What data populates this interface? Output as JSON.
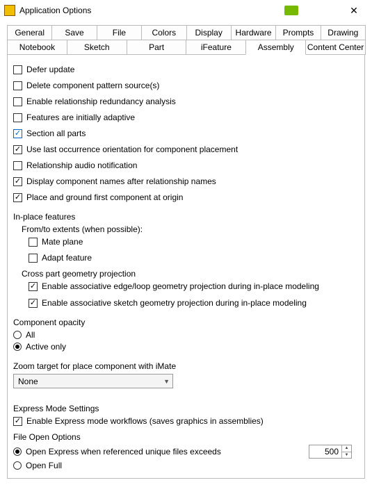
{
  "window": {
    "title": "Application Options",
    "close_symbol": "✕"
  },
  "tabs_row1": {
    "general": "General",
    "save": "Save",
    "file": "File",
    "colors": "Colors",
    "display": "Display",
    "hardware": "Hardware",
    "prompts": "Prompts",
    "drawing": "Drawing"
  },
  "tabs_row2": {
    "notebook": "Notebook",
    "sketch": "Sketch",
    "part": "Part",
    "ifeature": "iFeature",
    "assembly": "Assembly",
    "content_center": "Content Center"
  },
  "options": {
    "defer_update": "Defer update",
    "delete_pattern": "Delete component pattern source(s)",
    "enable_redundancy": "Enable relationship redundancy analysis",
    "features_adaptive": "Features are initially adaptive",
    "section_all": "Section all parts",
    "use_last_occ": "Use last occurrence orientation for component placement",
    "audio_notif": "Relationship audio notification",
    "display_names": "Display component names after relationship names",
    "place_ground": "Place and ground first component at origin"
  },
  "inplace": {
    "title": "In-place features",
    "fromto": "From/to extents (when possible):",
    "mate_plane": "Mate plane",
    "adapt_feature": "Adapt feature",
    "cross_title": "Cross part geometry projection",
    "edge_loop": "Enable associative edge/loop geometry projection during in-place modeling",
    "sketch_geo": "Enable associative sketch geometry projection during in-place modeling"
  },
  "opacity": {
    "title": "Component opacity",
    "all": "All",
    "active": "Active only"
  },
  "zoom": {
    "title": "Zoom target for place component with iMate",
    "value": "None"
  },
  "express": {
    "title": "Express Mode Settings",
    "enable": "Enable Express mode workflows (saves graphics in assemblies)",
    "file_open": "File Open Options",
    "open_express": "Open Express when referenced unique files exceeds",
    "open_full": "Open Full",
    "threshold": "500"
  }
}
